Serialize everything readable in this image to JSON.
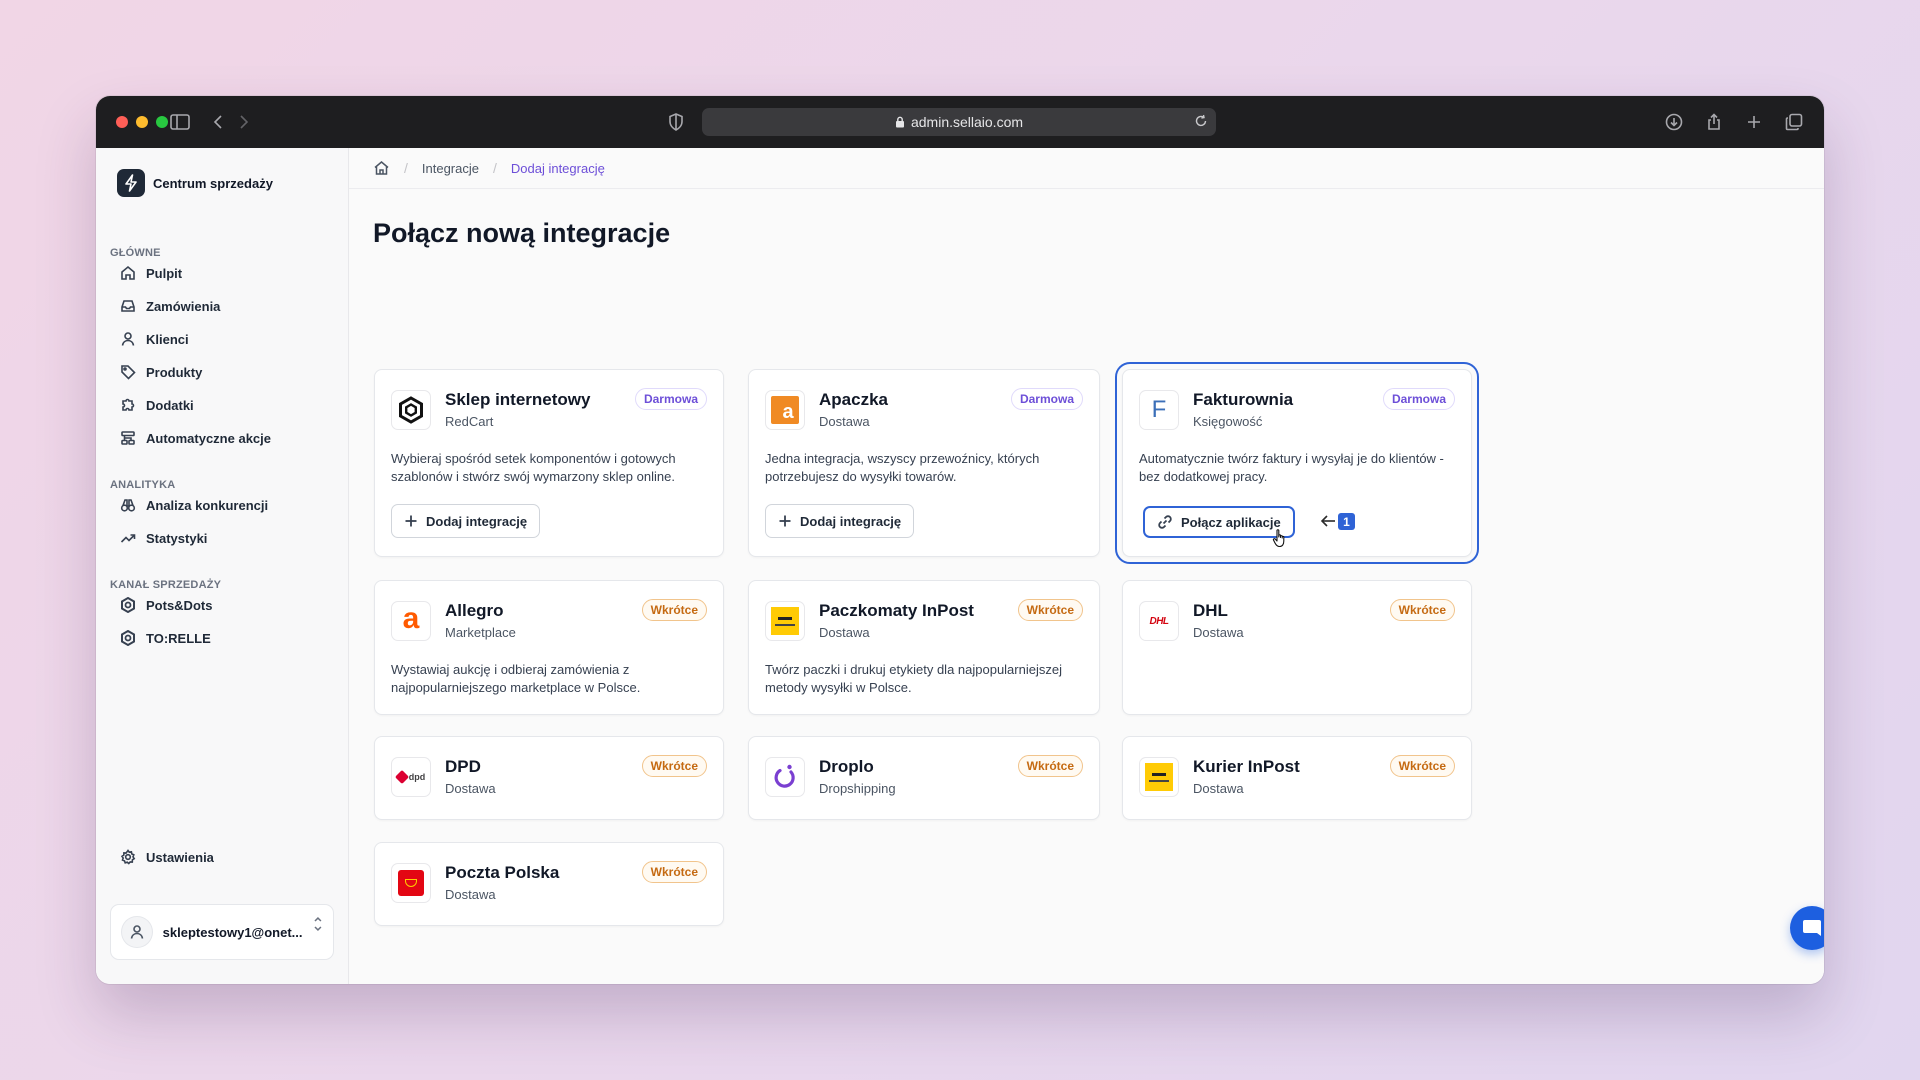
{
  "browser": {
    "url": "admin.sellaio.com"
  },
  "sidebar": {
    "brand": "Centrum sprzedaży",
    "sections": [
      {
        "label": "GŁÓWNE",
        "items": [
          "Pulpit",
          "Zamówienia",
          "Klienci",
          "Produkty",
          "Dodatki",
          "Automatyczne akcje"
        ]
      },
      {
        "label": "ANALITYKA",
        "items": [
          "Analiza konkurencji",
          "Statystyki"
        ]
      },
      {
        "label": "KANAŁ SPRZEDAŻY",
        "items": [
          "Pots&Dots",
          "TO:RELLE"
        ]
      }
    ],
    "settings": "Ustawienia",
    "user_email": "skleptestowy1@onet..."
  },
  "breadcrumb": {
    "items": [
      "Integracje",
      "Dodaj integrację"
    ]
  },
  "page_title": "Połącz nową integracje",
  "cards": [
    {
      "title": "Sklep internetowy",
      "subtitle": "RedCart",
      "badge": "Darmowa",
      "description": "Wybieraj spośród setek komponentów i gotowych szablonów i stwórz swój wymarzony sklep online.",
      "button": "Dodaj integrację"
    },
    {
      "title": "Apaczka",
      "subtitle": "Dostawa",
      "badge": "Darmowa",
      "description": "Jedna integracja, wszyscy przewoźnicy, których potrzebujesz do wysyłki towarów.",
      "button": "Dodaj integrację"
    },
    {
      "title": "Fakturownia",
      "subtitle": "Księgowość",
      "badge": "Darmowa",
      "description": "Automatycznie twórz faktury i wysyłaj je do klientów - bez dodatkowej pracy.",
      "button": "Połącz aplikacje"
    },
    {
      "title": "Allegro",
      "subtitle": "Marketplace",
      "badge": "Wkrótce",
      "description": "Wystawiaj aukcję i odbieraj zamówienia z najpopularniejszego marketplace w Polsce."
    },
    {
      "title": "Paczkomaty InPost",
      "subtitle": "Dostawa",
      "badge": "Wkrótce",
      "description": "Twórz paczki i drukuj etykiety dla najpopularniejszej metody wysyłki w Polsce."
    },
    {
      "title": "DHL",
      "subtitle": "Dostawa",
      "badge": "Wkrótce"
    },
    {
      "title": "DPD",
      "subtitle": "Dostawa",
      "badge": "Wkrótce"
    },
    {
      "title": "Droplo",
      "subtitle": "Dropshipping",
      "badge": "Wkrótce"
    },
    {
      "title": "Kurier InPost",
      "subtitle": "Dostawa",
      "badge": "Wkrótce"
    },
    {
      "title": "Poczta Polska",
      "subtitle": "Dostawa",
      "badge": "Wkrótce"
    }
  ],
  "annotation": {
    "step": "1"
  },
  "logo_text": {
    "fakturownia": "F",
    "allegro": "a",
    "apaczka": "a",
    "dhl": "DHL",
    "dpd": "dpd"
  },
  "colors": {
    "accent_purple": "#6d4fd8",
    "selection_blue": "#2f63d6",
    "soon_orange": "#c56a12",
    "chat_blue": "#1d5fe0"
  }
}
